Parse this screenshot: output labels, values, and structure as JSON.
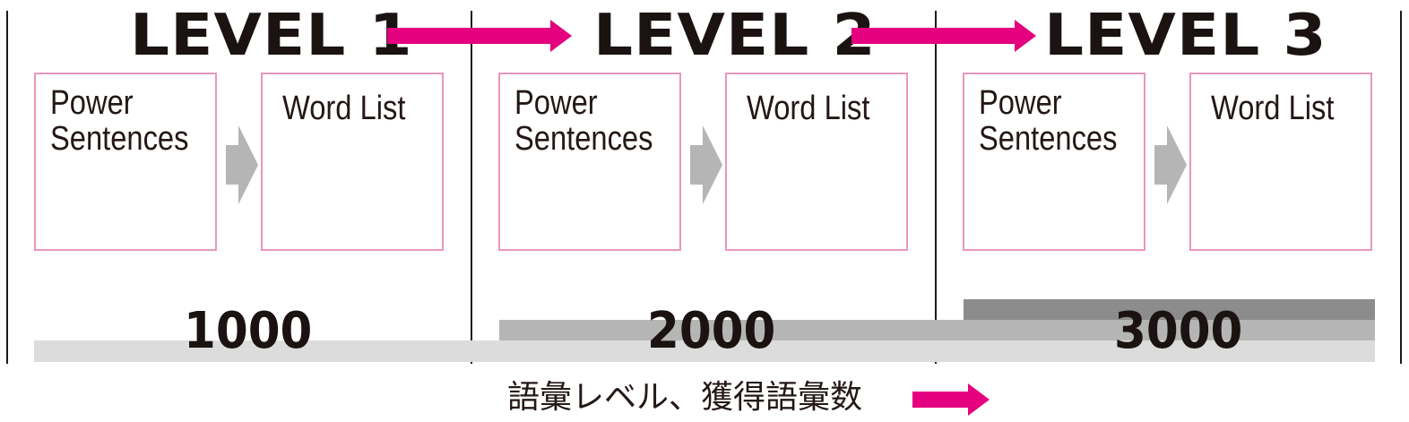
{
  "levels": [
    {
      "title": "LEVEL 1",
      "box_left": "Power\nSentences",
      "box_right": "Word List",
      "count": "1000"
    },
    {
      "title": "LEVEL 2",
      "box_left": "Power\nSentences",
      "box_right": "Word List",
      "count": "2000"
    },
    {
      "title": "LEVEL 3",
      "box_left": "Power\nSentences",
      "box_right": "Word List",
      "count": "3000"
    }
  ],
  "caption": "語彙レベル、獲得語彙数",
  "colors": {
    "accent_arrow": "#e4007f",
    "box_border": "#e897bd",
    "flow_arrow": "#b5b5b5",
    "bar_light": "#dcdcdc",
    "bar_mid": "#b5b5b5",
    "bar_dark": "#8c8c8c",
    "text": "#231815"
  },
  "icons": {
    "level_arrow": "right-arrow-icon",
    "flow_arrow": "right-arrow-icon",
    "caption_arrow": "right-arrow-icon"
  }
}
